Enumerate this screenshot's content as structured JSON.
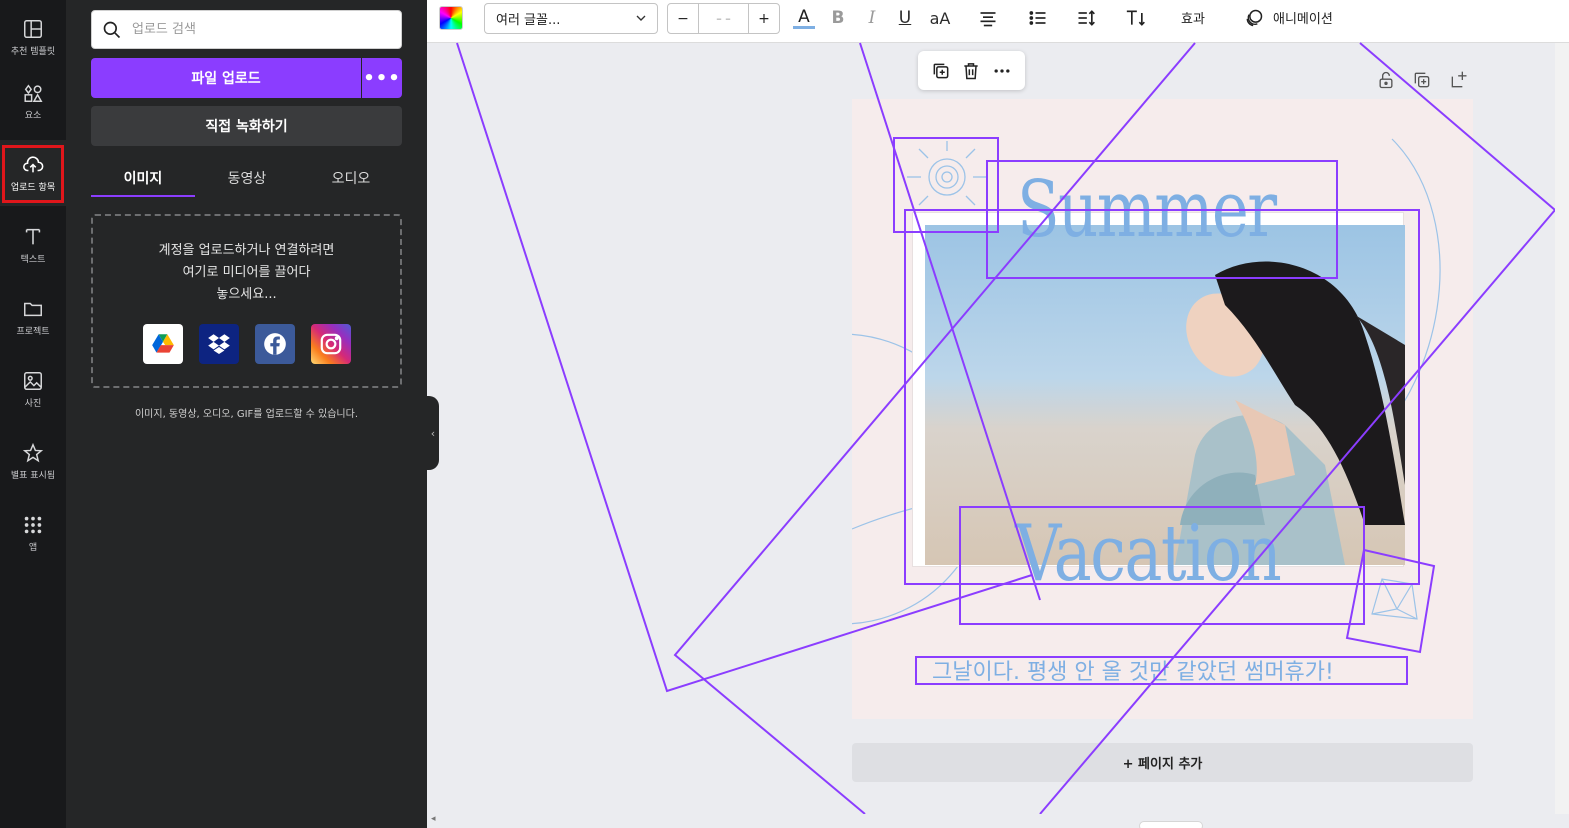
{
  "rail": {
    "items": [
      {
        "label": "추천 템플릿",
        "icon": "template-icon"
      },
      {
        "label": "요소",
        "icon": "elements-icon"
      },
      {
        "label": "업로드 항목",
        "icon": "cloud-upload-icon"
      },
      {
        "label": "텍스트",
        "icon": "text-icon"
      },
      {
        "label": "프로젝트",
        "icon": "folder-icon"
      },
      {
        "label": "사진",
        "icon": "photo-icon"
      },
      {
        "label": "별표 표시됨",
        "icon": "star-icon"
      },
      {
        "label": "앱",
        "icon": "apps-icon"
      }
    ],
    "active_index": 2
  },
  "panel": {
    "search_placeholder": "업로드 검색",
    "upload_button": "파일 업로드",
    "upload_more": "•••",
    "record_button": "직접 녹화하기",
    "tabs": [
      "이미지",
      "동영상",
      "오디오"
    ],
    "active_tab": 0,
    "drop_text_1": "계정을 업로드하거나 연결하려면",
    "drop_text_2": "여기로 미디어를 끌어다",
    "drop_text_3": "놓으세요...",
    "sources": [
      "google-drive-icon",
      "dropbox-icon",
      "facebook-icon",
      "instagram-icon"
    ],
    "note": "이미지, 동영상, 오디오, GIF를 업로드할 수 있습니다."
  },
  "toolbar": {
    "font_name": "여러 글꼴...",
    "size_minus": "−",
    "size_value": "– –",
    "size_plus": "+",
    "text_color_letter": "A",
    "bold": "B",
    "italic": "I",
    "underline": "U",
    "case": "aA",
    "effects": "효과",
    "animate": "애니메이션"
  },
  "canvas": {
    "title_top": "Summer",
    "title_bottom": "Vacation",
    "tagline": "그날이다. 평생 안 올 것만 같았던 썸머휴가!",
    "add_page": "+ 페이지 추가"
  },
  "colors": {
    "accent": "#8b3dff",
    "title_blue": "#7eafe3",
    "highlight_red": "#e0161b",
    "page_bg": "#f6ecec"
  }
}
